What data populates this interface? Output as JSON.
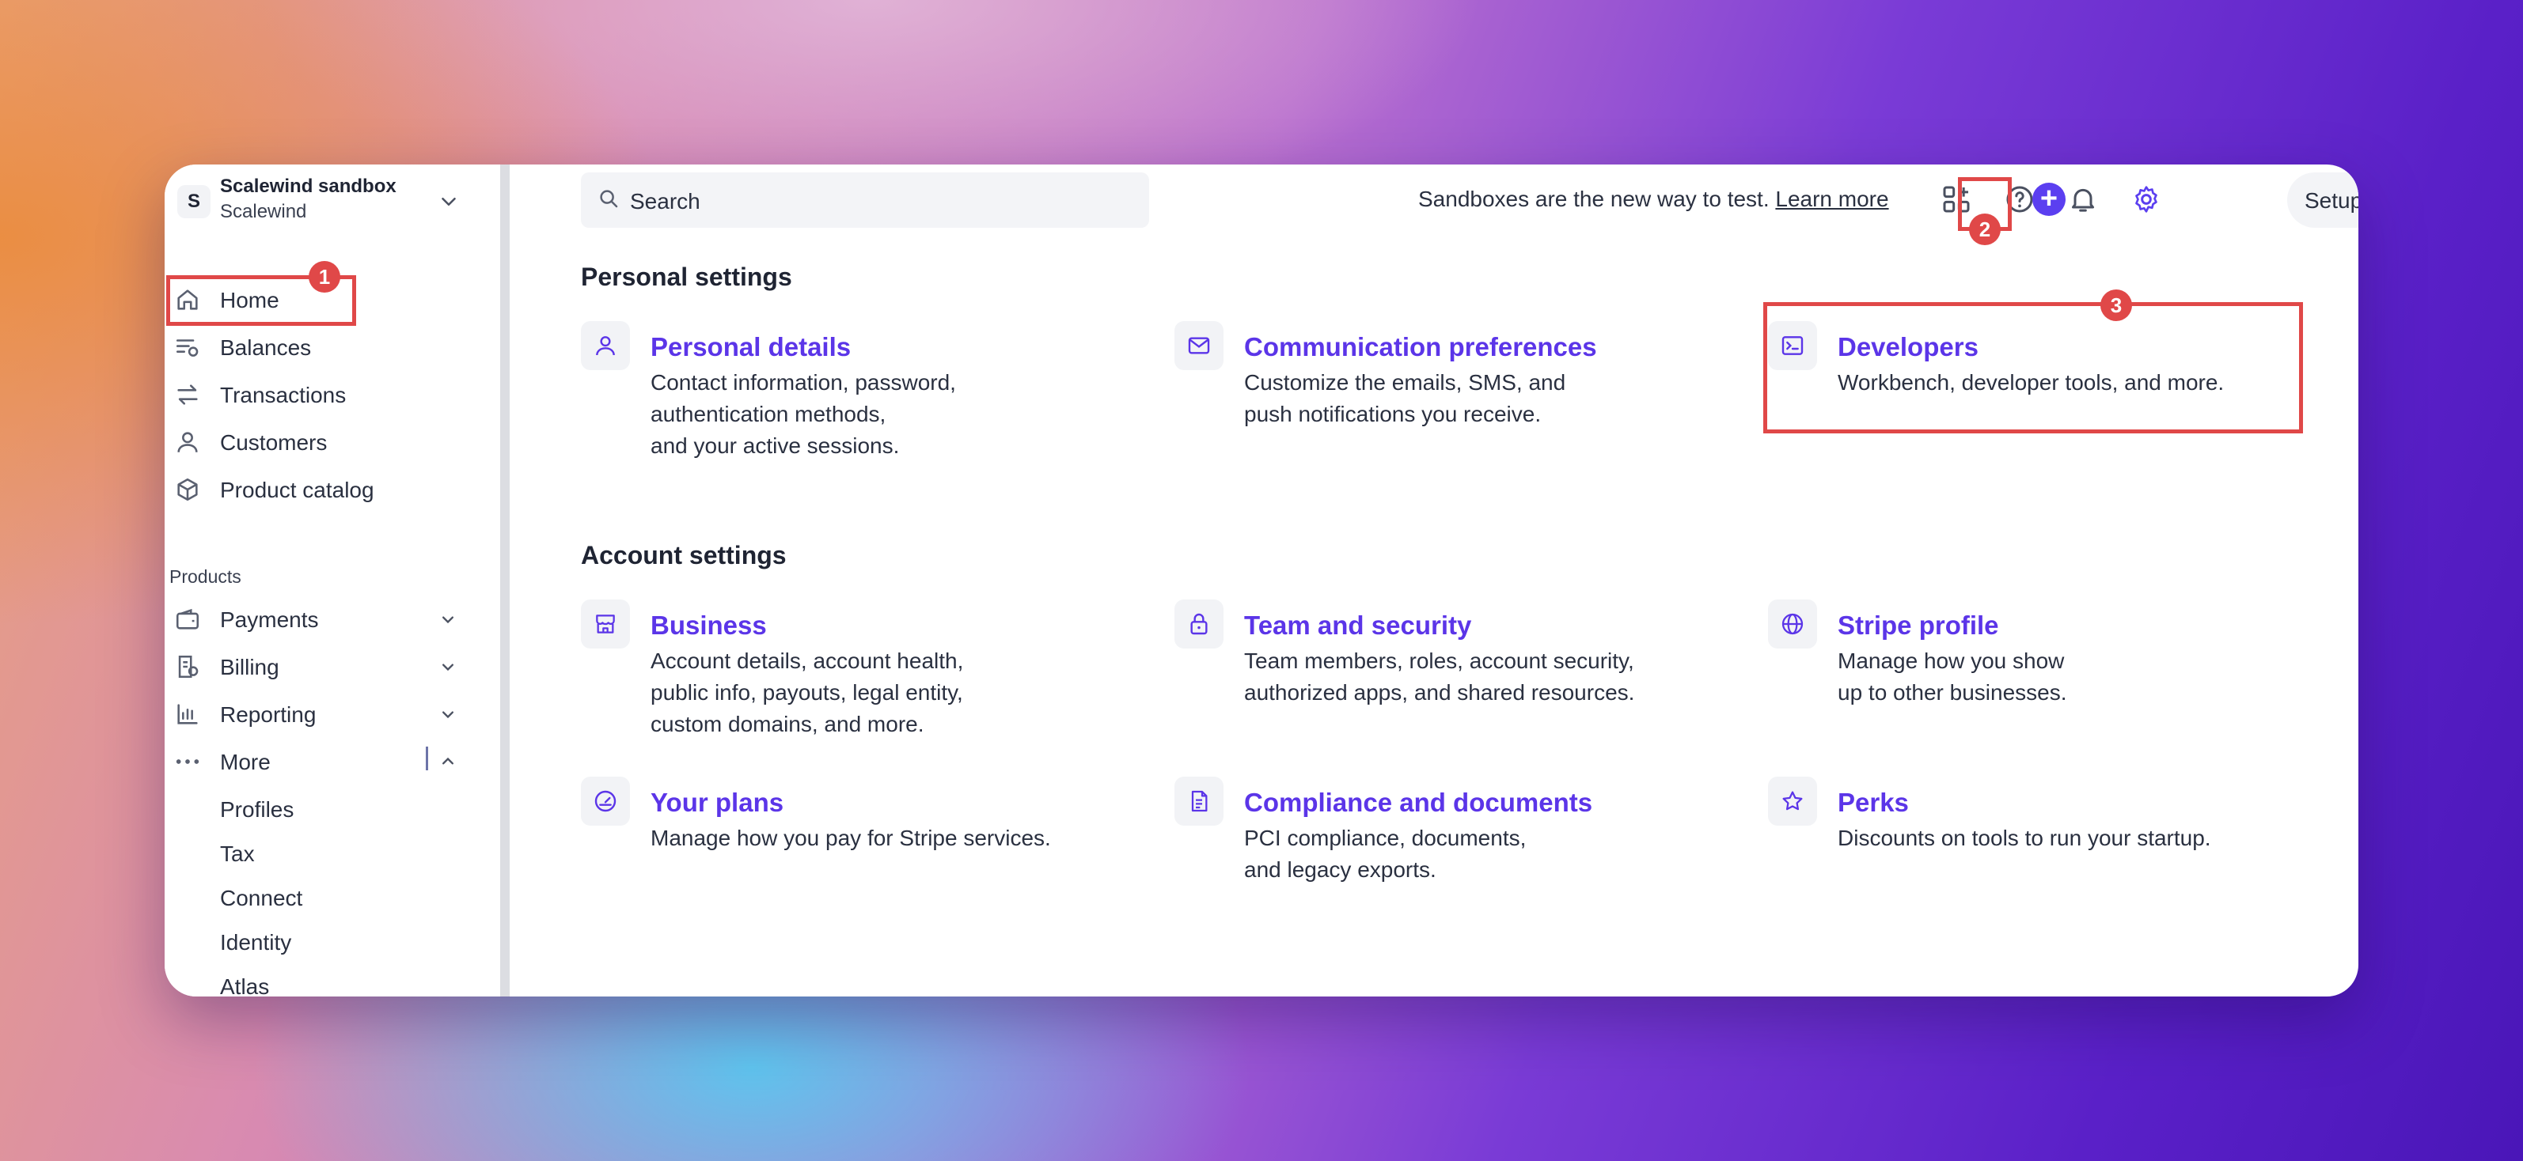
{
  "account": {
    "initial": "S",
    "name": "Scalewind sandbox",
    "org": "Scalewind"
  },
  "sidebar": {
    "items": [
      {
        "label": "Home"
      },
      {
        "label": "Balances"
      },
      {
        "label": "Transactions"
      },
      {
        "label": "Customers"
      },
      {
        "label": "Product catalog"
      }
    ],
    "products_label": "Products",
    "products": [
      {
        "label": "Payments"
      },
      {
        "label": "Billing"
      },
      {
        "label": "Reporting"
      },
      {
        "label": "More"
      }
    ],
    "more_items": [
      {
        "label": "Profiles"
      },
      {
        "label": "Tax"
      },
      {
        "label": "Connect"
      },
      {
        "label": "Identity"
      },
      {
        "label": "Atlas"
      }
    ]
  },
  "topbar": {
    "search_placeholder": "Search",
    "sandbox_message": "Sandboxes are the new way to test.",
    "learn_more": "Learn more",
    "plus_symbol": "+",
    "setup_guide": "Setup guide"
  },
  "personal": {
    "heading": "Personal settings",
    "cards": [
      {
        "title": "Personal details",
        "lines": [
          "Contact information, password,",
          "authentication methods,",
          "and your active sessions."
        ]
      },
      {
        "title": "Communication preferences",
        "lines": [
          "Customize the emails, SMS, and",
          "push notifications you receive."
        ]
      },
      {
        "title": "Developers",
        "lines": [
          "Workbench, developer tools, and more."
        ]
      }
    ]
  },
  "account_settings": {
    "heading": "Account settings",
    "cards": [
      {
        "title": "Business",
        "lines": [
          "Account details, account health,",
          "public info, payouts, legal entity,",
          "custom domains, and more."
        ]
      },
      {
        "title": "Team and security",
        "lines": [
          "Team members, roles, account security,",
          "authorized apps, and shared resources."
        ]
      },
      {
        "title": "Stripe profile",
        "lines": [
          "Manage how you show",
          "up to other businesses."
        ]
      },
      {
        "title": "Your plans",
        "lines": [
          "Manage how you pay for Stripe services."
        ]
      },
      {
        "title": "Compliance and documents",
        "lines": [
          "PCI compliance, documents,",
          "and legacy exports."
        ]
      },
      {
        "title": "Perks",
        "lines": [
          "Discounts on tools to run your startup."
        ]
      }
    ]
  },
  "annotations": {
    "badge1": "1",
    "badge2": "2",
    "badge3": "3"
  },
  "colors": {
    "accent": "#5b35e8",
    "annotation": "#e04848"
  }
}
